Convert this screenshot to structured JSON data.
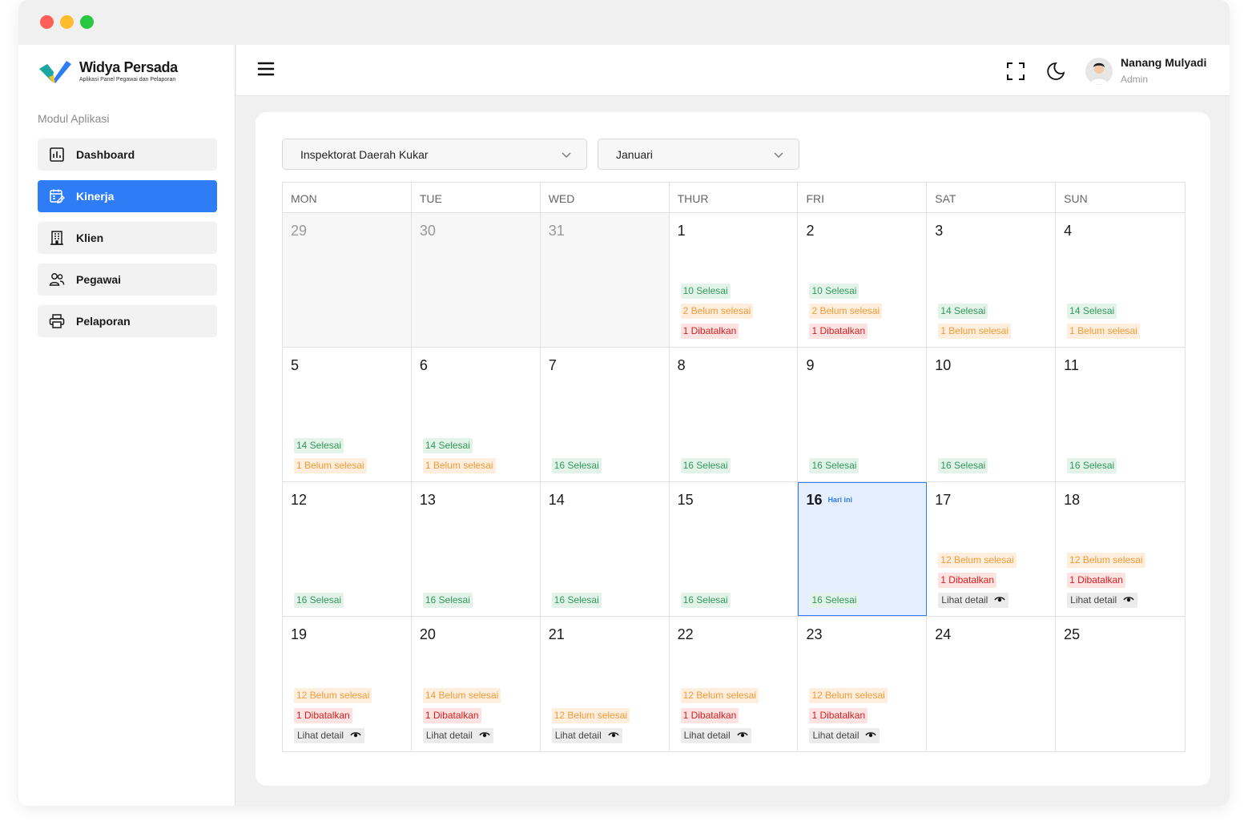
{
  "brand": {
    "name": "Widya Persada",
    "tagline": "Aplikasi Panel Pegawai dan Pelaporan"
  },
  "sidebar": {
    "section_title": "Modul Aplikasi",
    "items": [
      {
        "label": "Dashboard",
        "icon": "chart-icon",
        "active": false
      },
      {
        "label": "Kinerja",
        "icon": "calendar-edit-icon",
        "active": true
      },
      {
        "label": "Klien",
        "icon": "building-icon",
        "active": false
      },
      {
        "label": "Pegawai",
        "icon": "users-icon",
        "active": false
      },
      {
        "label": "Pelaporan",
        "icon": "printer-icon",
        "active": false
      }
    ]
  },
  "topbar": {
    "icons": [
      "menu-icon",
      "fullscreen-icon",
      "moon-icon"
    ],
    "user": {
      "name": "Nanang Mulyadi",
      "role": "Admin"
    }
  },
  "filters": {
    "organization": "Inspektorat Daerah Kukar",
    "month": "Januari"
  },
  "calendar": {
    "headers": [
      "MON",
      "TUE",
      "WED",
      "THUR",
      "FRI",
      "SAT",
      "SUN"
    ],
    "today_label": "Hari ini",
    "detail_label": "Lihat detail",
    "colors": {
      "selesai": "#2f9a5c",
      "belum": "#f29b38",
      "batal": "#d61f1f",
      "accent": "#2e7cf6"
    },
    "weeks": [
      [
        {
          "day": "29",
          "prev": true,
          "badges": []
        },
        {
          "day": "30",
          "prev": true,
          "badges": []
        },
        {
          "day": "31",
          "prev": true,
          "badges": []
        },
        {
          "day": "1",
          "badges": [
            {
              "type": "green",
              "text": "10 Selesai"
            },
            {
              "type": "orange",
              "text": "2 Belum selesai"
            },
            {
              "type": "red",
              "text": "1 Dibatalkan"
            }
          ]
        },
        {
          "day": "2",
          "badges": [
            {
              "type": "green",
              "text": "10 Selesai"
            },
            {
              "type": "orange",
              "text": "2 Belum selesai"
            },
            {
              "type": "red",
              "text": "1 Dibatalkan"
            }
          ]
        },
        {
          "day": "3",
          "badges": [
            {
              "type": "green",
              "text": "14 Selesai"
            },
            {
              "type": "orange",
              "text": "1 Belum selesai"
            }
          ]
        },
        {
          "day": "4",
          "badges": [
            {
              "type": "green",
              "text": "14 Selesai"
            },
            {
              "type": "orange",
              "text": "1 Belum selesai"
            }
          ]
        }
      ],
      [
        {
          "day": "5",
          "badges": [
            {
              "type": "green",
              "text": "14 Selesai"
            },
            {
              "type": "orange",
              "text": "1 Belum selesai"
            }
          ]
        },
        {
          "day": "6",
          "badges": [
            {
              "type": "green",
              "text": "14 Selesai"
            },
            {
              "type": "orange",
              "text": "1 Belum selesai"
            }
          ]
        },
        {
          "day": "7",
          "badges": [
            {
              "type": "green",
              "text": "16 Selesai"
            }
          ]
        },
        {
          "day": "8",
          "badges": [
            {
              "type": "green",
              "text": "16 Selesai"
            }
          ]
        },
        {
          "day": "9",
          "badges": [
            {
              "type": "green",
              "text": "16 Selesai"
            }
          ]
        },
        {
          "day": "10",
          "badges": [
            {
              "type": "green",
              "text": "16 Selesai"
            }
          ]
        },
        {
          "day": "11",
          "badges": [
            {
              "type": "green",
              "text": "16 Selesai"
            }
          ]
        }
      ],
      [
        {
          "day": "12",
          "badges": [
            {
              "type": "green",
              "text": "16 Selesai"
            }
          ]
        },
        {
          "day": "13",
          "badges": [
            {
              "type": "green",
              "text": "16 Selesai"
            }
          ]
        },
        {
          "day": "14",
          "badges": [
            {
              "type": "green",
              "text": "16 Selesai"
            }
          ]
        },
        {
          "day": "15",
          "badges": [
            {
              "type": "green",
              "text": "16 Selesai"
            }
          ]
        },
        {
          "day": "16",
          "today": true,
          "badges": [
            {
              "type": "green",
              "text": "16 Selesai"
            }
          ]
        },
        {
          "day": "17",
          "badges": [
            {
              "type": "orange",
              "text": "12 Belum selesai"
            },
            {
              "type": "red",
              "text": "1 Dibatalkan"
            },
            {
              "type": "detail",
              "text": "Lihat detail"
            }
          ]
        },
        {
          "day": "18",
          "badges": [
            {
              "type": "orange",
              "text": "12 Belum selesai"
            },
            {
              "type": "red",
              "text": "1 Dibatalkan"
            },
            {
              "type": "detail",
              "text": "Lihat detail"
            }
          ]
        }
      ],
      [
        {
          "day": "19",
          "badges": [
            {
              "type": "orange",
              "text": "12 Belum selesai"
            },
            {
              "type": "red",
              "text": "1 Dibatalkan"
            },
            {
              "type": "detail",
              "text": "Lihat detail"
            }
          ]
        },
        {
          "day": "20",
          "badges": [
            {
              "type": "orange",
              "text": "14 Belum selesai"
            },
            {
              "type": "red",
              "text": "1 Dibatalkan"
            },
            {
              "type": "detail",
              "text": "Lihat detail"
            }
          ]
        },
        {
          "day": "21",
          "badges": [
            {
              "type": "orange",
              "text": "12 Belum selesai"
            },
            {
              "type": "detail",
              "text": "Lihat detail"
            }
          ]
        },
        {
          "day": "22",
          "badges": [
            {
              "type": "orange",
              "text": "12 Belum selesai"
            },
            {
              "type": "red",
              "text": "1 Dibatalkan"
            },
            {
              "type": "detail",
              "text": "Lihat detail"
            }
          ]
        },
        {
          "day": "23",
          "badges": [
            {
              "type": "orange",
              "text": "12 Belum selesai"
            },
            {
              "type": "red",
              "text": "1 Dibatalkan"
            },
            {
              "type": "detail",
              "text": "Lihat detail"
            }
          ]
        },
        {
          "day": "24",
          "badges": []
        },
        {
          "day": "25",
          "badges": []
        }
      ]
    ]
  }
}
